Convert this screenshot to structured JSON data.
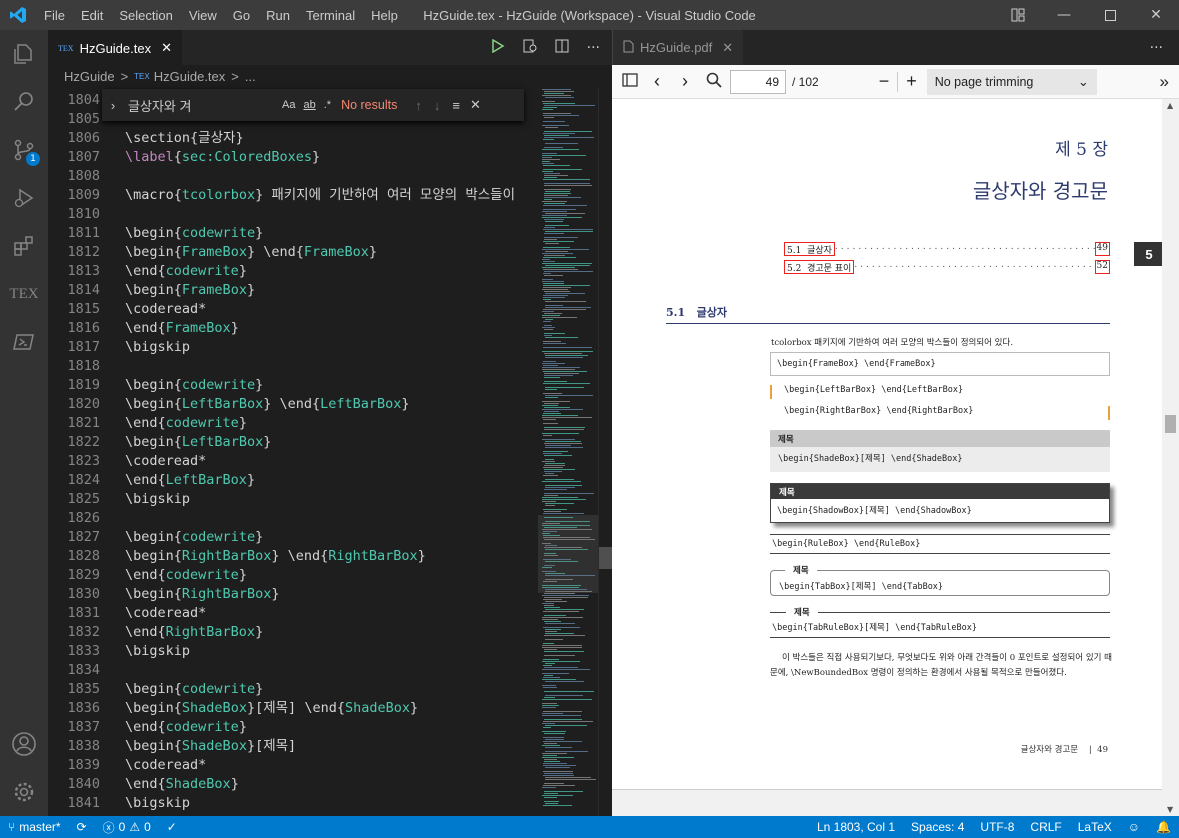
{
  "app": {
    "title": "HzGuide.tex - HzGuide (Workspace) - Visual Studio Code",
    "menu": [
      "File",
      "Edit",
      "Selection",
      "View",
      "Go",
      "Run",
      "Terminal",
      "Help"
    ],
    "accent": "#007acc"
  },
  "activity": {
    "icons": [
      "explorer-icon",
      "search-icon",
      "source-control-icon",
      "run-debug-icon",
      "extensions-icon",
      "tex-icon",
      "powershell-icon",
      "account-icon",
      "settings-gear-icon"
    ],
    "tex_label": "TEX",
    "scm_badge": "1"
  },
  "editor": {
    "tab_label": "HzGuide.tex",
    "tab_prefix": "TEX",
    "breadcrumb": [
      "HzGuide",
      ">",
      "HzGuide.tex",
      ">",
      "..."
    ],
    "find": {
      "value": "글상자와 겨",
      "result": "No results",
      "case": "Aa",
      "word": "ab",
      "regex": ".*"
    },
    "lines": [
      {
        "n": "1804",
        "t": ""
      },
      {
        "n": "1805",
        "t": ""
      },
      {
        "n": "1806",
        "t": "\\section{글상자}"
      },
      {
        "n": "1807",
        "t": "\\label{sec:ColoredBoxes}"
      },
      {
        "n": "1808",
        "t": ""
      },
      {
        "n": "1809",
        "t": "\\macro{tcolorbox} 패키지에 기반하여 여러 모양의 박스들이"
      },
      {
        "n": "1810",
        "t": ""
      },
      {
        "n": "1811",
        "t": "\\begin{codewrite}"
      },
      {
        "n": "1812",
        "t": "\\begin{FrameBox} \\end{FrameBox}"
      },
      {
        "n": "1813",
        "t": "\\end{codewrite}"
      },
      {
        "n": "1814",
        "t": "\\begin{FrameBox}"
      },
      {
        "n": "1815",
        "t": "\\coderead*"
      },
      {
        "n": "1816",
        "t": "\\end{FrameBox}"
      },
      {
        "n": "1817",
        "t": "\\bigskip"
      },
      {
        "n": "1818",
        "t": ""
      },
      {
        "n": "1819",
        "t": "\\begin{codewrite}"
      },
      {
        "n": "1820",
        "t": "\\begin{LeftBarBox} \\end{LeftBarBox}"
      },
      {
        "n": "1821",
        "t": "\\end{codewrite}"
      },
      {
        "n": "1822",
        "t": "\\begin{LeftBarBox}"
      },
      {
        "n": "1823",
        "t": "\\coderead*"
      },
      {
        "n": "1824",
        "t": "\\end{LeftBarBox}"
      },
      {
        "n": "1825",
        "t": "\\bigskip"
      },
      {
        "n": "1826",
        "t": ""
      },
      {
        "n": "1827",
        "t": "\\begin{codewrite}"
      },
      {
        "n": "1828",
        "t": "\\begin{RightBarBox} \\end{RightBarBox}"
      },
      {
        "n": "1829",
        "t": "\\end{codewrite}"
      },
      {
        "n": "1830",
        "t": "\\begin{RightBarBox}"
      },
      {
        "n": "1831",
        "t": "\\coderead*"
      },
      {
        "n": "1832",
        "t": "\\end{RightBarBox}"
      },
      {
        "n": "1833",
        "t": "\\bigskip"
      },
      {
        "n": "1834",
        "t": ""
      },
      {
        "n": "1835",
        "t": "\\begin{codewrite}"
      },
      {
        "n": "1836",
        "t": "\\begin{ShadeBox}[제목] \\end{ShadeBox}"
      },
      {
        "n": "1837",
        "t": "\\end{codewrite}"
      },
      {
        "n": "1838",
        "t": "\\begin{ShadeBox}[제목]"
      },
      {
        "n": "1839",
        "t": "\\coderead*"
      },
      {
        "n": "1840",
        "t": "\\end{ShadeBox}"
      },
      {
        "n": "1841",
        "t": "\\bigskip"
      }
    ]
  },
  "pdf": {
    "tab_label": "HzGuide.pdf",
    "page_input": "49",
    "page_total": "/ 102",
    "trim": "No page trimming",
    "chapter_num": "제 5 장",
    "chapter_title": "글상자와 경고문",
    "toc": [
      {
        "num": "5.1",
        "title": "글상자",
        "page": "49"
      },
      {
        "num": "5.2",
        "title": "경고문 표이",
        "page": "52"
      }
    ],
    "thumb_tab": "5",
    "section": {
      "num": "5.1",
      "title": "글상자"
    },
    "intro": "tcolorbox 패키지에 기반하여 여러 모양의 박스들이 정의되어 있다.",
    "boxes": {
      "frame": "\\begin{FrameBox} \\end{FrameBox}",
      "leftbar": "\\begin{LeftBarBox} \\end{LeftBarBox}",
      "rightbar": "\\begin{RightBarBox} \\end{RightBarBox}",
      "shade_title": "제목",
      "shade_body": "\\begin{ShadeBox}[제목] \\end{ShadeBox}",
      "shadow_title": "제목",
      "shadow_body": "\\begin{ShadowBox}[제목] \\end{ShadowBox}",
      "rule_body": "\\begin{RuleBox} \\end{RuleBox}",
      "tab_title": "제목",
      "tab_body": "\\begin{TabBox}[제목] \\end{TabBox}",
      "tabrule_title": "제목",
      "tabrule_body": "\\begin{TabRuleBox}[제목] \\end{TabRuleBox}"
    },
    "para": "이 박스들은 직접 사용되기보다, 무엇보다도 위와 아래 간격들이 0 포인트로 설정되어 있기 때문에, \\NewBoundedBox 명령이 정의하는 환경에서 사용될 목적으로 만들어졌다.",
    "footer": "글상자와 경고문",
    "footer_page": "49"
  },
  "status": {
    "branch": "master*",
    "sync": "⟳",
    "errors": "0",
    "warnings": "0",
    "check": "✓",
    "position": "Ln 1803, Col 1",
    "spaces": "Spaces: 4",
    "encoding": "UTF-8",
    "eol": "CRLF",
    "language": "LaTeX"
  }
}
